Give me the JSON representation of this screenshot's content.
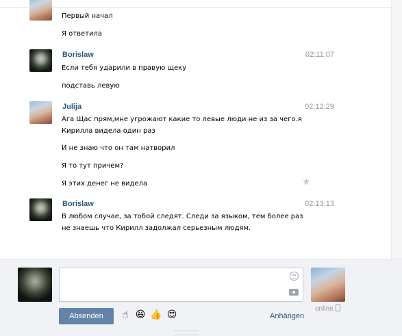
{
  "messages": [
    {
      "text": "Первый начал"
    },
    {
      "text": "Я ответила"
    },
    {
      "author": "Borislaw",
      "time": "02:11:07",
      "text": "Если тебя ударили в правую щеку"
    },
    {
      "text": "подставь левую"
    },
    {
      "author": "Julija",
      "time": "02:12:29",
      "text": "Ага Щас прям,мне угрожают какие то левые люди не из за чего.я Кирилла видела один раз"
    },
    {
      "text": "И не знаю что он там натворил"
    },
    {
      "text": "Я то тут причем?"
    },
    {
      "text": "Я этих денег не видела"
    },
    {
      "author": "Borislaw",
      "time": "02:13:13",
      "text": "В любом случае, за тобой следят. Следи за языком, тем более раз не знаешь что Кирилл задолжал серьезным людям."
    }
  ],
  "composer": {
    "send_label": "Absenden",
    "attach_label": "Anhängen",
    "peer_status": "online",
    "emojis": [
      "☝",
      "😆",
      "👍",
      "😍"
    ]
  },
  "icons": {
    "star": "star-icon",
    "smile": "smile-icon",
    "camera": "camera-icon",
    "phone": "mobile-phone-icon"
  }
}
